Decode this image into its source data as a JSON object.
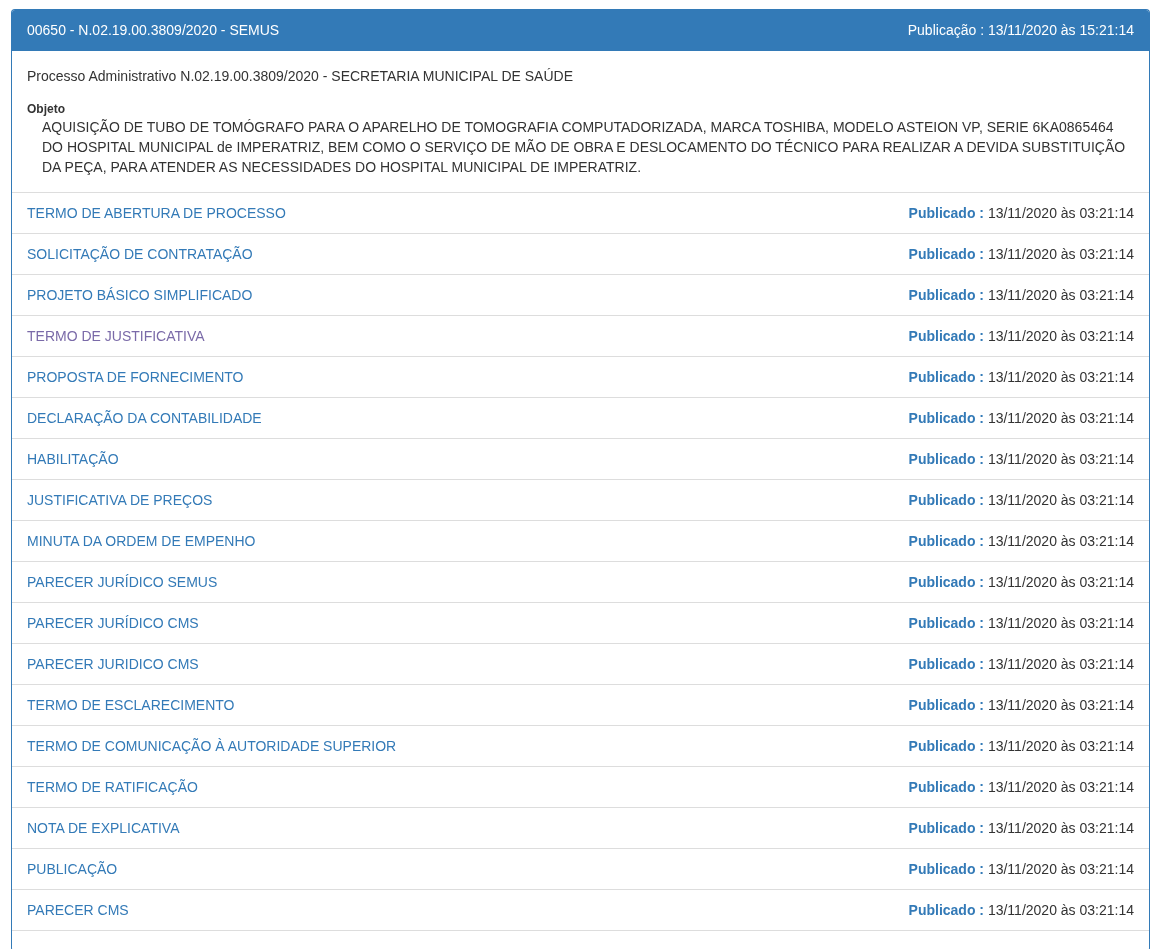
{
  "panel": {
    "title": "00650 - N.02.19.00.3809/2020 - SEMUS",
    "publication": "Publicação : 13/11/2020 às 15:21:14",
    "process": "Processo Administrativo N.02.19.00.3809/2020 - SECRETARIA MUNICIPAL DE SAÚDE",
    "object_label": "Objeto",
    "object_text": "AQUISIÇÃO DE TUBO DE TOMÓGRAFO PARA O APARELHO DE TOMOGRAFIA COMPUTADORIZADA, MARCA TOSHIBA, MODELO ASTEION VP, SERIE 6KA0865464 DO HOSPITAL MUNICIPAL de IMPERATRIZ, BEM COMO O SERVIÇO DE MÃO DE OBRA E DESLOCAMENTO DO TÉCNICO PARA REALIZAR A DEVIDA SUBSTITUIÇÃO DA PEÇA, PARA ATENDER AS NECESSIDADES DO HOSPITAL MUNICIPAL DE IMPERATRIZ."
  },
  "documents": [
    {
      "name": "TERMO DE ABERTURA DE PROCESSO",
      "visited": false,
      "label": "Publicado :",
      "date": "13/11/2020 às 03:21:14"
    },
    {
      "name": "SOLICITAÇÃO DE CONTRATAÇÃO",
      "visited": false,
      "label": "Publicado :",
      "date": "13/11/2020 às 03:21:14"
    },
    {
      "name": "PROJETO BÁSICO SIMPLIFICADO",
      "visited": false,
      "label": "Publicado :",
      "date": "13/11/2020 às 03:21:14"
    },
    {
      "name": "TERMO DE JUSTIFICATIVA",
      "visited": true,
      "label": "Publicado :",
      "date": "13/11/2020 às 03:21:14"
    },
    {
      "name": "PROPOSTA DE FORNECIMENTO",
      "visited": false,
      "label": "Publicado :",
      "date": "13/11/2020 às 03:21:14"
    },
    {
      "name": "DECLARAÇÃO DA CONTABILIDADE",
      "visited": false,
      "label": "Publicado :",
      "date": "13/11/2020 às 03:21:14"
    },
    {
      "name": "HABILITAÇÃO",
      "visited": false,
      "label": "Publicado :",
      "date": "13/11/2020 às 03:21:14"
    },
    {
      "name": "JUSTIFICATIVA DE PREÇOS",
      "visited": false,
      "label": "Publicado :",
      "date": "13/11/2020 às 03:21:14"
    },
    {
      "name": "MINUTA DA ORDEM DE EMPENHO",
      "visited": false,
      "label": "Publicado :",
      "date": "13/11/2020 às 03:21:14"
    },
    {
      "name": "PARECER JURÍDICO SEMUS",
      "visited": false,
      "label": "Publicado :",
      "date": "13/11/2020 às 03:21:14"
    },
    {
      "name": "PARECER JURÍDICO CMS",
      "visited": false,
      "label": "Publicado :",
      "date": "13/11/2020 às 03:21:14"
    },
    {
      "name": "PARECER JURIDICO CMS",
      "visited": false,
      "label": "Publicado :",
      "date": "13/11/2020 às 03:21:14"
    },
    {
      "name": "TERMO DE ESCLARECIMENTO",
      "visited": false,
      "label": "Publicado :",
      "date": "13/11/2020 às 03:21:14"
    },
    {
      "name": "TERMO DE COMUNICAÇÃO À AUTORIDADE SUPERIOR",
      "visited": false,
      "label": "Publicado :",
      "date": "13/11/2020 às 03:21:14"
    },
    {
      "name": "TERMO DE RATIFICAÇÃO",
      "visited": false,
      "label": "Publicado :",
      "date": "13/11/2020 às 03:21:14"
    },
    {
      "name": "NOTA DE EXPLICATIVA",
      "visited": false,
      "label": "Publicado :",
      "date": "13/11/2020 às 03:21:14"
    },
    {
      "name": "PUBLICAÇÃO",
      "visited": false,
      "label": "Publicado :",
      "date": "13/11/2020 às 03:21:14"
    },
    {
      "name": "PARECER CMS",
      "visited": false,
      "label": "Publicado :",
      "date": "13/11/2020 às 03:21:14"
    }
  ]
}
